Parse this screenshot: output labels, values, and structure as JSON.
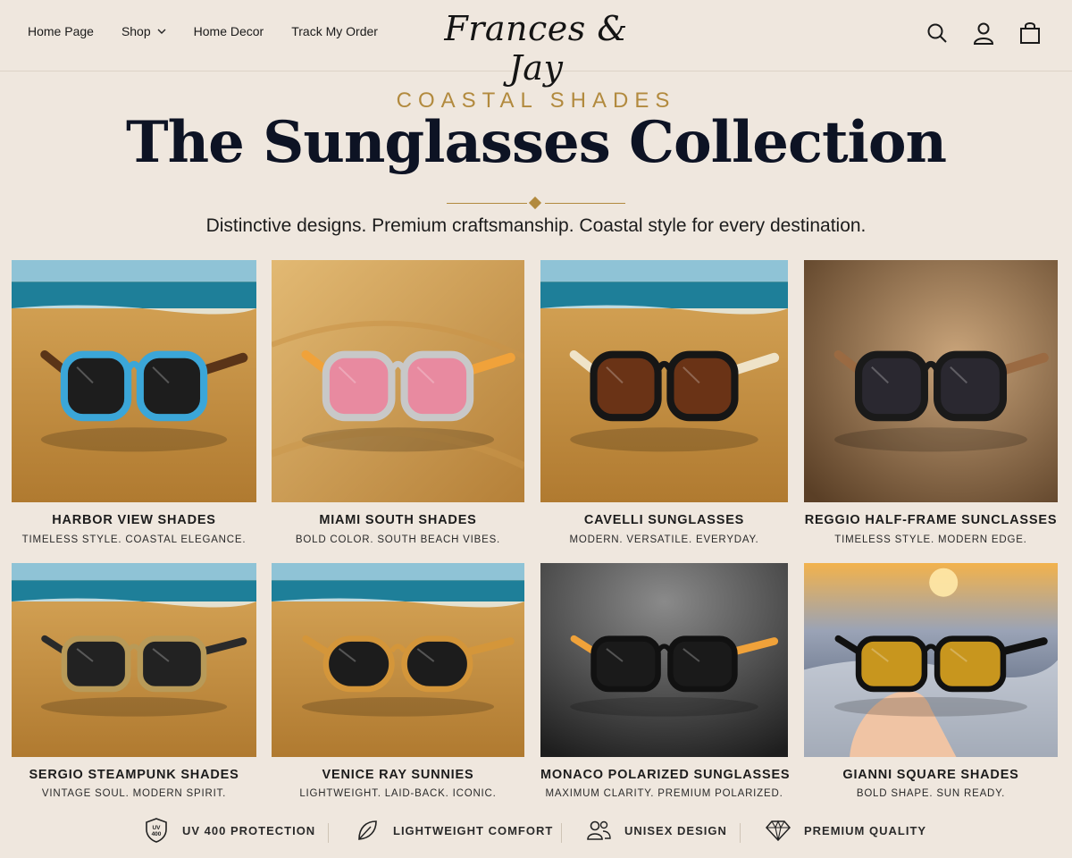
{
  "header": {
    "nav": [
      {
        "label": "Home Page"
      },
      {
        "label": "Shop"
      },
      {
        "label": "Home Decor"
      },
      {
        "label": "Track My Order"
      }
    ],
    "logo": "Frances & Jay",
    "icons": [
      "search-icon",
      "account-icon",
      "cart-icon"
    ]
  },
  "hero": {
    "eyebrow": "COASTAL SHADES",
    "title": "The Sunglasses Collection",
    "subtitle": "Distinctive designs. Premium craftsmanship. Coastal style for every destination."
  },
  "products": [
    {
      "name": "HARBOR VIEW SHADES",
      "tagline": "TIMELESS STYLE. COASTAL ELEGANCE.",
      "frame": "#3ba6d8",
      "lens": "#1d1d1d",
      "temple": "#5a3418",
      "scene": "beach"
    },
    {
      "name": "MIAMI SOUTH SHADES",
      "tagline": "BOLD COLOR. SOUTH BEACH VIBES.",
      "frame": "#c8c8c8",
      "lens": "#e88aa0",
      "temple": "#f0a23a",
      "scene": "sand"
    },
    {
      "name": "CAVELLI SUNGLASSES",
      "tagline": "MODERN. VERSATILE. EVERYDAY.",
      "frame": "#161616",
      "lens": "#6a3316",
      "temple": "#efe3c8",
      "scene": "beach"
    },
    {
      "name": "REGGIO HALF-FRAME SUNCLASSES",
      "tagline": "TIMELESS STYLE. MODERN EDGE.",
      "frame": "#1a1a1a",
      "lens": "#2a2830",
      "temple": "#9a6a42",
      "scene": "studio"
    },
    {
      "name": "SERGIO STEAMPUNK SHADES",
      "tagline": "VINTAGE SOUL. MODERN SPIRIT.",
      "frame": "#b89a58",
      "lens": "#222222",
      "temple": "#2a2a2a",
      "scene": "beach"
    },
    {
      "name": "VENICE RAY SUNNIES",
      "tagline": "LIGHTWEIGHT. LAID-BACK. ICONIC.",
      "frame": "#d4963a",
      "lens": "#1c1c1c",
      "temple": "#d4963a",
      "scene": "beach"
    },
    {
      "name": "MONACO POLARIZED SUNGLASSES",
      "tagline": "MAXIMUM CLARITY. PREMIUM POLARIZED.",
      "frame": "#111111",
      "lens": "#1a1a1a",
      "temple": "#f0a23a",
      "scene": "dark"
    },
    {
      "name": "GIANNI SQUARE SHADES",
      "tagline": "BOLD SHAPE. SUN READY.",
      "frame": "#111111",
      "lens": "#c8961e",
      "temple": "#111111",
      "scene": "sunset"
    }
  ],
  "features": [
    {
      "label": "UV 400 PROTECTION",
      "icon": "uv-shield-icon",
      "badge": "UV 400"
    },
    {
      "label": "LIGHTWEIGHT COMFORT",
      "icon": "leaf-icon"
    },
    {
      "label": "UNISEX DESIGN",
      "icon": "people-icon"
    },
    {
      "label": "PREMIUM QUALITY",
      "icon": "diamond-icon"
    }
  ]
}
